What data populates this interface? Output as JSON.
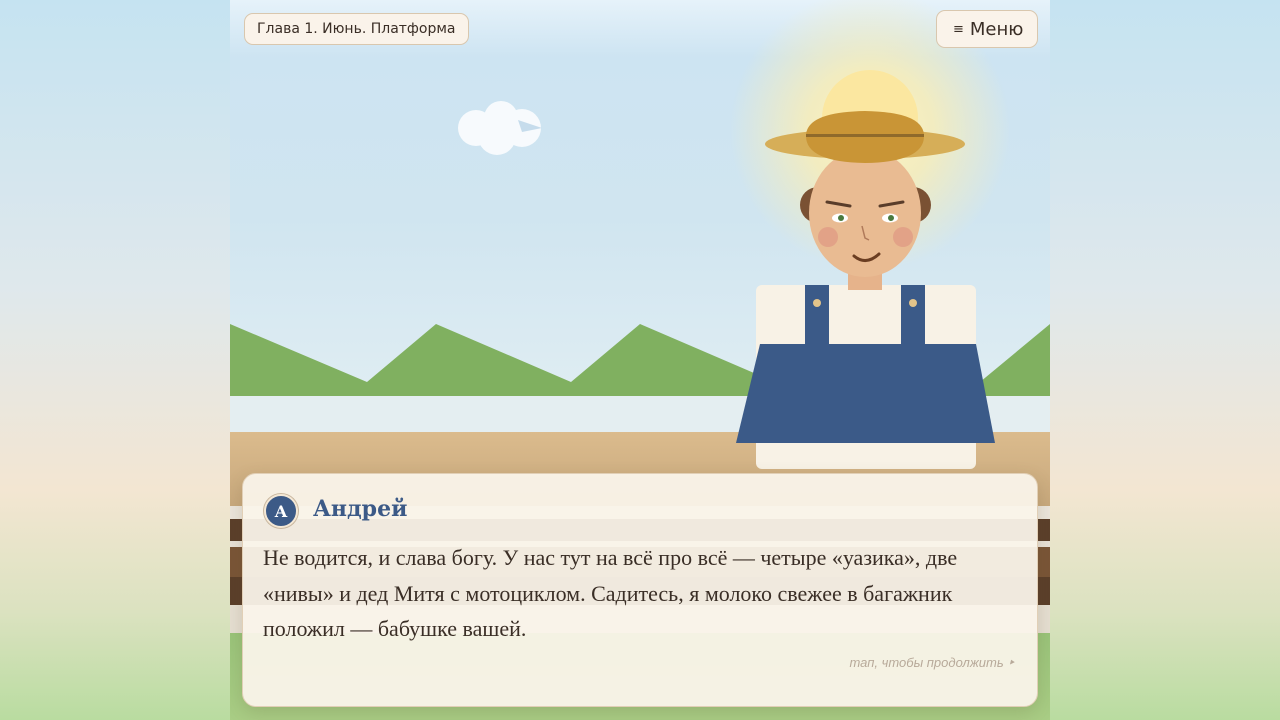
{
  "hud": {
    "chapter_label": "Глава 1. Июнь. Платформа",
    "menu_icon": "≡",
    "menu_label": "Меню"
  },
  "dialog": {
    "speaker_initial": "А",
    "speaker_name": "Андрей",
    "text": "Не водится, и слава богу. У нас тут на всё про всё — четыре «уазика», две «нивы» и дед Митя с мотоциклом. Садитесь, я молоко свежее в багажник положил — бабушке вашей.",
    "continue_hint": "тап, чтобы продолжить",
    "continue_arrow": "‣"
  },
  "colors": {
    "accent": "#3c5a87",
    "overalls": "#3b5a88",
    "hills": "#80b060",
    "ground": "#d6b68a",
    "straw_hat": "#d6ae58",
    "sun": "#fbe7a0"
  }
}
